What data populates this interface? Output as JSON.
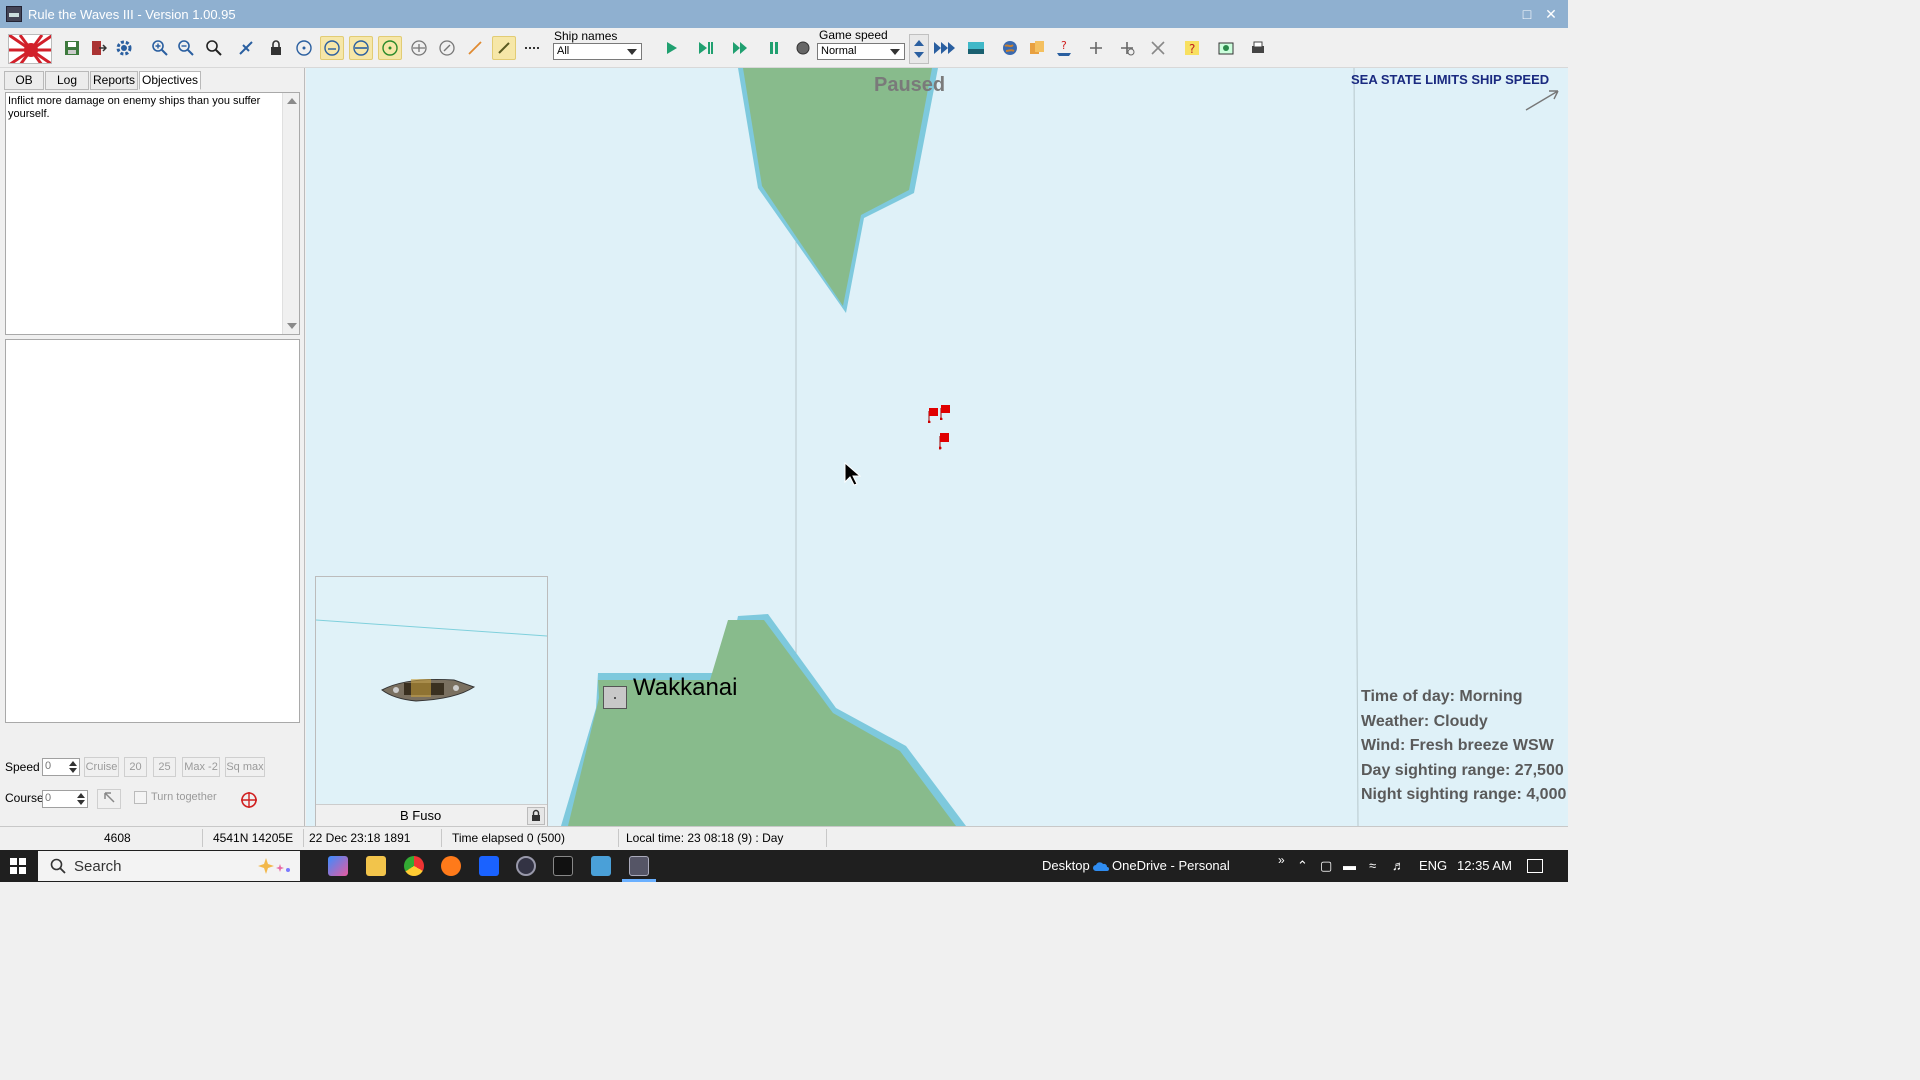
{
  "window": {
    "title": "Rule the Waves III - Version 1.00.95"
  },
  "toolbar": {
    "ship_names_label": "Ship names",
    "ship_names_value": "All",
    "game_speed_label": "Game speed",
    "game_speed_value": "Normal"
  },
  "left_panel": {
    "tabs": [
      "OB",
      "Log",
      "Reports",
      "Objectives"
    ],
    "active_tab": "Objectives",
    "objectives_text": "Inflict more damage on enemy ships than you suffer yourself.",
    "speed_label": "Speed",
    "speed_value": "0",
    "course_label": "Course",
    "course_value": "0",
    "buttons": {
      "cruise": "Cruise",
      "s20": "20",
      "s25": "25",
      "max2": "Max -2",
      "sqmax": "Sq max"
    },
    "turn_together": "Turn together"
  },
  "map": {
    "paused": "Paused",
    "sea_state": "SEA STATE LIMITS SHIP SPEED",
    "location": "Wakkanai",
    "ship_preview_name": "B Fuso",
    "info": {
      "time_of_day": "Time of day: Morning",
      "weather": "Weather: Cloudy",
      "wind": "Wind: Fresh breeze  WSW",
      "day_sighting": "Day sighting range: 27,500",
      "night_sighting": "Night sighting range: 4,000"
    }
  },
  "statusbar": {
    "id": "4608",
    "coords": "4541N 14205E",
    "date": "22 Dec 23:18 1891",
    "elapsed": "Time elapsed 0 (500)",
    "local_time": "Local time: 23 08:18 (9) : Day"
  },
  "taskbar": {
    "search_placeholder": "Search",
    "desktop": "Desktop",
    "onedrive": "OneDrive - Personal",
    "lang": "ENG",
    "clock": "12:35 AM"
  }
}
